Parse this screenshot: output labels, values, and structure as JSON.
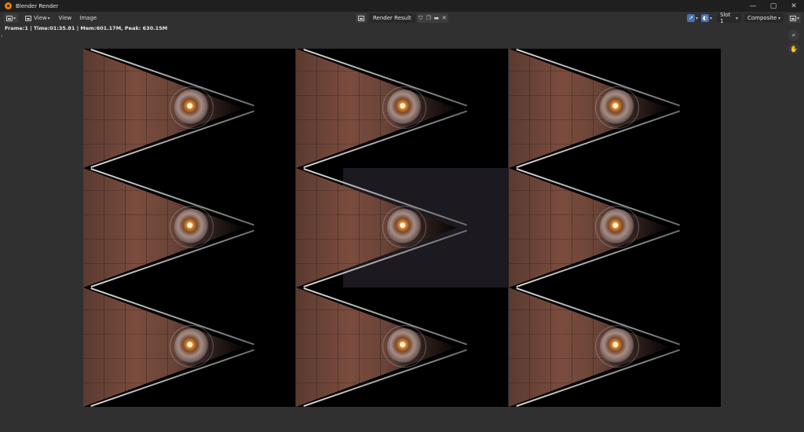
{
  "window": {
    "title": "Blender Render",
    "controls": {
      "minimize": "—",
      "maximize": "▢",
      "close": "✕"
    }
  },
  "header": {
    "view_toggle_label": "View",
    "menus": [
      "View",
      "Image"
    ],
    "image_name": "Render Result",
    "slot": "Slot 1",
    "layer": "Composite"
  },
  "info": {
    "text": "Frame:1 | Time:01:35.81 | Mem:601.17M, Peak: 630.15M"
  },
  "icons": {
    "app": "blender-logo-icon",
    "zoom": "magnifier-icon",
    "pan": "hand-icon"
  },
  "colors": {
    "accent": "#4772b3",
    "app_icon": "#e87d0d",
    "background": "#303030"
  }
}
